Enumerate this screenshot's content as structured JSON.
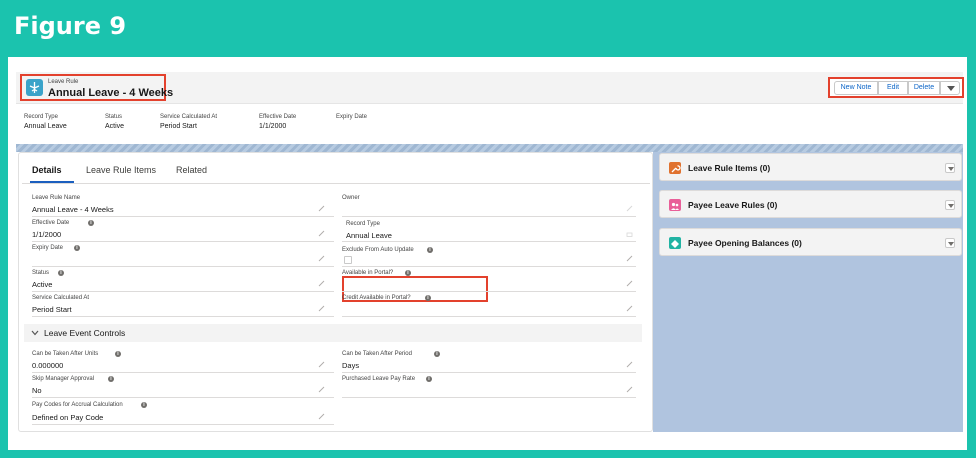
{
  "figure": {
    "title": "Figure 9"
  },
  "record": {
    "object_label": "Leave Rule",
    "name": "Annual Leave - 4 Weeks",
    "actions": {
      "new_note": "New Note",
      "edit": "Edit",
      "delete": "Delete"
    },
    "header_fields": [
      {
        "label": "Record Type",
        "value": "Annual Leave"
      },
      {
        "label": "Status",
        "value": "Active"
      },
      {
        "label": "Service Calculated At",
        "value": "Period Start"
      },
      {
        "label": "Effective Date",
        "value": "1/1/2000"
      },
      {
        "label": "Expiry Date",
        "value": ""
      }
    ]
  },
  "tabs": [
    "Details",
    "Leave Rule Items",
    "Related"
  ],
  "details": {
    "leave_rule_name": {
      "label": "Leave Rule Name",
      "value": "Annual Leave - 4 Weeks"
    },
    "owner": {
      "label": "Owner",
      "value": ""
    },
    "effective_date": {
      "label": "Effective Date",
      "value": "1/1/2000"
    },
    "record_type": {
      "label": "Record Type",
      "value": "Annual Leave"
    },
    "expiry_date": {
      "label": "Expiry Date",
      "value": ""
    },
    "exclude_auto_update": {
      "label": "Exclude From Auto Update",
      "checked": false
    },
    "status": {
      "label": "Status",
      "value": "Active"
    },
    "available_in_portal": {
      "label": "Available in Portal?",
      "value": ""
    },
    "service_calculated_at": {
      "label": "Service Calculated At",
      "value": "Period Start"
    },
    "credit_available_in_portal": {
      "label": "Credit Available in Portal?",
      "value": ""
    }
  },
  "leave_event_controls": {
    "title": "Leave Event Controls",
    "can_be_taken_after_units": {
      "label": "Can be Taken After Units",
      "value": "0.000000"
    },
    "can_be_taken_after_period": {
      "label": "Can be Taken After Period",
      "value": "Days"
    },
    "skip_manager_approval": {
      "label": "Skip Manager Approval",
      "value": "No"
    },
    "purchased_leave_pay_rate": {
      "label": "Purchased Leave Pay Rate",
      "value": ""
    },
    "pay_codes_for_accrual": {
      "label": "Pay Codes for Accrual Calculation",
      "value": "Defined on Pay Code"
    }
  },
  "related_lists": [
    {
      "title": "Leave Rule Items (0)",
      "color": "#e0722f",
      "icon": "wrench-icon"
    },
    {
      "title": "Payee Leave Rules (0)",
      "color": "#e95f99",
      "icon": "people-icon"
    },
    {
      "title": "Payee Opening Balances (0)",
      "color": "#21b3a3",
      "icon": "diamond-icon"
    }
  ],
  "colors": {
    "frame": "#1bc3ae",
    "highlight": "#e3412d",
    "link": "#0b64c7",
    "side_background": "#b0c4df"
  }
}
